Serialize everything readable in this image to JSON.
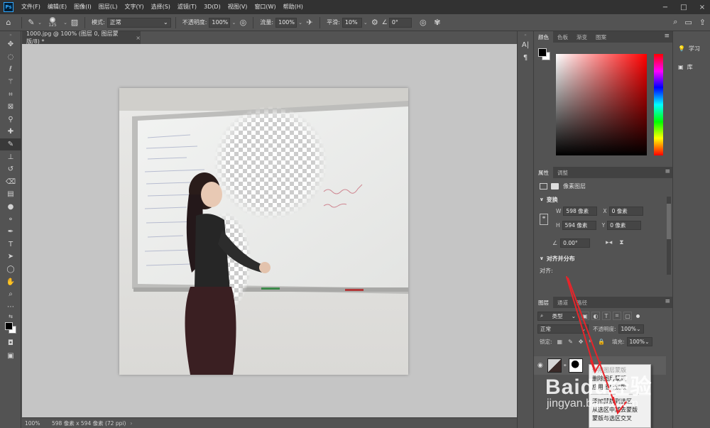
{
  "app": {
    "logo": "Ps"
  },
  "menu": [
    "文件(F)",
    "编辑(E)",
    "图像(I)",
    "图层(L)",
    "文字(Y)",
    "选择(S)",
    "滤镜(T)",
    "3D(D)",
    "视图(V)",
    "窗口(W)",
    "帮助(H)"
  ],
  "window_controls": [
    "−",
    "□",
    "×"
  ],
  "options": {
    "brush_size": "125",
    "mode_label": "模式:",
    "mode_value": "正常",
    "opacity_label": "不透明度:",
    "opacity_value": "100%",
    "flow_label": "流量:",
    "flow_value": "100%",
    "smoothing_label": "平滑:",
    "smoothing_value": "10%",
    "angle_value": "0°"
  },
  "document": {
    "tab_title": "1000.jpg @ 100% (图层 0, 图层蒙版/8) *",
    "zoom": "100%",
    "info": "598 像素 x 594 像素 (72 ppi)"
  },
  "color_panel": {
    "tabs": [
      "颜色",
      "色板",
      "渐变",
      "图案"
    ]
  },
  "properties_panel": {
    "tabs": [
      "属性",
      "调整"
    ],
    "layer_type": "像素图层",
    "transform_heading": "变换",
    "w_label": "W",
    "w_value": "598 像素",
    "h_label": "H",
    "h_value": "594 像素",
    "x_label": "X",
    "x_value": "0 像素",
    "y_label": "Y",
    "y_value": "0 像素",
    "angle_value": "0.00°",
    "align_heading": "对齐并分布",
    "align_label": "对齐:"
  },
  "layers_panel": {
    "tabs": [
      "图层",
      "通道",
      "路径"
    ],
    "filter_kind": "类型",
    "blend_mode": "正常",
    "opacity_label": "不透明度:",
    "opacity_value": "100%",
    "lock_label": "锁定:",
    "fill_label": "填充:",
    "fill_value": "100%"
  },
  "context_menu": [
    {
      "label": "停用图层蒙版",
      "state": "partially-obscured"
    },
    {
      "label": "删除图层蒙版",
      "state": "partially-obscured"
    },
    {
      "label": "应用图层蒙版",
      "state": "partially-obscured"
    },
    {
      "label": "添加蒙版到选区",
      "state": "partially-obscured"
    },
    {
      "label": "从选区中减去蒙版",
      "state": "normal"
    },
    {
      "label": "蒙版与选区交叉",
      "state": "normal"
    }
  ],
  "far_right": {
    "learn": "学习",
    "library": "库"
  },
  "watermark": {
    "brand": "Baidu经验",
    "url": "jingyan.baidu.com"
  },
  "colors": {
    "annotation_arrow": "#e8242a",
    "menubar": "#323232",
    "panel": "#535353"
  }
}
